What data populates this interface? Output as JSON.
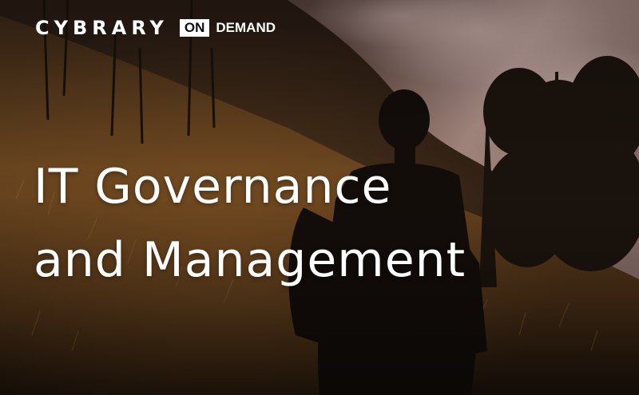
{
  "brand": {
    "name": "CYBRARY",
    "badge": "ON",
    "suffix": "DEMAND"
  },
  "course": {
    "title_line1": "IT Governance",
    "title_line2": "and Management"
  },
  "colors": {
    "text": "#ffffff",
    "badge_bg": "#ffffff",
    "badge_text": "#0d0d0d",
    "sky": "#a08580",
    "hill": "#5a3a1e"
  }
}
